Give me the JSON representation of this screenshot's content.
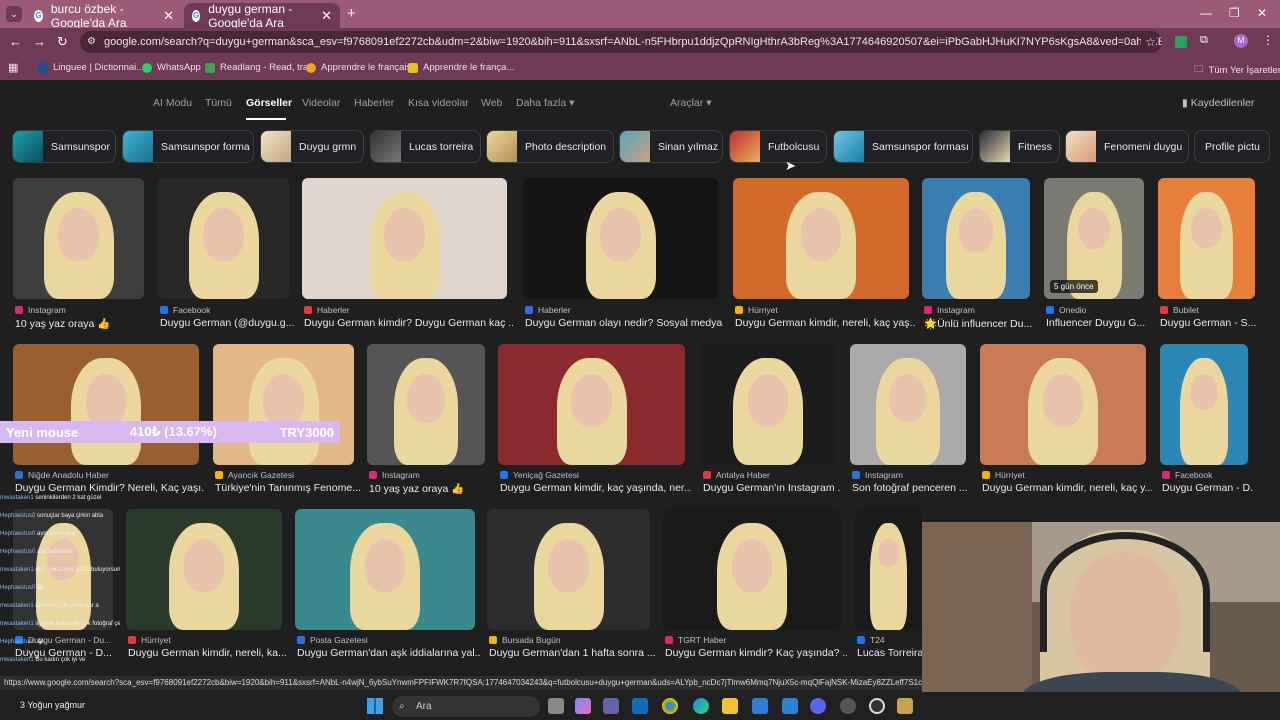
{
  "tabs": [
    {
      "title": "burcu özbek - Google'da Ara"
    },
    {
      "title": "duygu german - Google'da Ara"
    }
  ],
  "address": {
    "url": "google.com/search?q=duygu+german&sca_esv=f9768091ef2272cb&udm=2&biw=1920&bih=911&sxsrf=ANbL-n5FHbrpu1ddjzQpRNIgHthrA3bReg%3A1774646920507&ei=iPbGabHJHuKI7NYP6sKgsA8&ved=0ahUKEwixrbH6gsGTAxViBNsEHWohC..."
  },
  "bookmarks": [
    "Linguee | Dictionnai...",
    "WhatsApp",
    "Readlang - Read, tra...",
    "Apprendre le français",
    "Apprendre le françа...",
    "Tüm Yer İşaretleri"
  ],
  "google_nav": {
    "items": [
      "AI Modu",
      "Tümü",
      "Görseller",
      "Videolar",
      "Haberler",
      "Kısa videolar",
      "Web",
      "Daha fazla"
    ],
    "tools": "Araçlar",
    "saved": "Kaydedilenler"
  },
  "chips": [
    "Samsunspor",
    "Samsunspor forma",
    "Duygu grmn",
    "Lucas torreira",
    "Photo description",
    "Sinan yılmaz",
    "Futbolcusu",
    "Samsunspor forması",
    "Fitness",
    "Fenomeni duygu",
    "Profile pictu"
  ],
  "results_row1": [
    {
      "source": "Instagram",
      "caption": "10 yaş yaz oraya 👍"
    },
    {
      "source": "Facebook",
      "caption": "Duygu German (@duygu.g..."
    },
    {
      "source": "Haberler",
      "caption": "Duygu German kimdir? Duygu German kaç ..."
    },
    {
      "source": "Haberler",
      "caption": "Duygu German olayı nedir? Sosyal medya ..."
    },
    {
      "source": "Hürriyet",
      "caption": "Duygu German kimdir, nereli, kaç yaş..."
    },
    {
      "source": "Instagram",
      "caption": "🌟Ünlü influencer Du..."
    },
    {
      "source": "Onedio",
      "caption": "Influencer Duygu G...",
      "badge": "5 gün önce"
    },
    {
      "source": "Bubilet",
      "caption": "Duygu German - S..."
    }
  ],
  "results_row2": [
    {
      "source": "Niğde Anadolu Haber",
      "caption": "Duygu German Kimdir? Nereli, Kaç yaşı..."
    },
    {
      "source": "Ayancık Gazetesi",
      "caption": "Türkiye'nin Tanınmış Fenome..."
    },
    {
      "source": "Instagram",
      "caption": "10 yaş yaz oraya 👍"
    },
    {
      "source": "Yeniçağ Gazetesi",
      "caption": "Duygu German kimdir, kaç yaşında, ner..."
    },
    {
      "source": "Antalya Haber",
      "caption": "Duygu German'ın Instagram ..."
    },
    {
      "source": "Instagram",
      "caption": "Son fotoğraf penceren ..."
    },
    {
      "source": "Hürriyet",
      "caption": "Duygu German kimdir, nereli, kaç y..."
    },
    {
      "source": "Facebook",
      "caption": "Duygu German - D..."
    }
  ],
  "results_row3": [
    {
      "source": "Duygu German - Du...",
      "caption": "Duygu German - D..."
    },
    {
      "source": "Hürriyet",
      "caption": "Duygu German kimdir, nereli, ka..."
    },
    {
      "source": "Posta Gazetesi",
      "caption": "Duygu German'dan aşk iddialarına yal..."
    },
    {
      "source": "Bursada Bugün",
      "caption": "Duygu German'dan 1 hafta sonra ..."
    },
    {
      "source": "TGRT Haber",
      "caption": "Duygu German kimdir? Kaç yaşında? ..."
    },
    {
      "source": "T24",
      "caption": "Lucas Torreira i..."
    }
  ],
  "overlay": {
    "label": "Yeni mouse",
    "amount": "410₺ (13.67%)",
    "goal": "TRY3000"
  },
  "chat": [
    {
      "user": "mwastaken1",
      "text": "seninkilerden 2 kat güzel"
    },
    {
      "user": "Hephaestus0",
      "text": "sonuçlar baya çirkin abla"
    },
    {
      "user": "Hephaestus0",
      "text": "aynı evlendiler"
    },
    {
      "user": "Hephaestus0",
      "text": "alla zamanda"
    },
    {
      "user": "mwastaken1",
      "text": "ooo, yoruz mu güzel buluyorsunuz"
    },
    {
      "user": "Hephaestus0",
      "text": "😂"
    },
    {
      "user": "mwastaken1",
      "text": "diklemiş çok çirkin var a"
    },
    {
      "user": "mwastaken1",
      "text": "ilgilerle forum gerçek fotoğraf çekilmemiş"
    },
    {
      "user": "Hephaestus0",
      "text": "😂"
    },
    {
      "user": "mwastaken1",
      "text": "Bu kadın çok iyi ve"
    }
  ],
  "status_url": "https://www.google.com/search?sca_esv=f9768091ef2272cb&biw=1920&bih=911&sxsrf=ANbL-n4wjN_6ybSuYnwmFPFIFWK7R7fQSA:1774647034243&q=futbolcusu+duygu+german&uds=ALYpb_ncDc7jTlmw6Mmq7NjuX5c-mqQlFajNSK-MizaEy8ZZLeff7S1cQ9f",
  "taskbar": {
    "weather": "3 Yoğun yağmur",
    "search": "Ara"
  },
  "colors": {
    "tabbar": "#9b5a78",
    "toolbar": "#6f3a57",
    "page": "#1f1f1f",
    "overlay": "#d7b8f2"
  }
}
